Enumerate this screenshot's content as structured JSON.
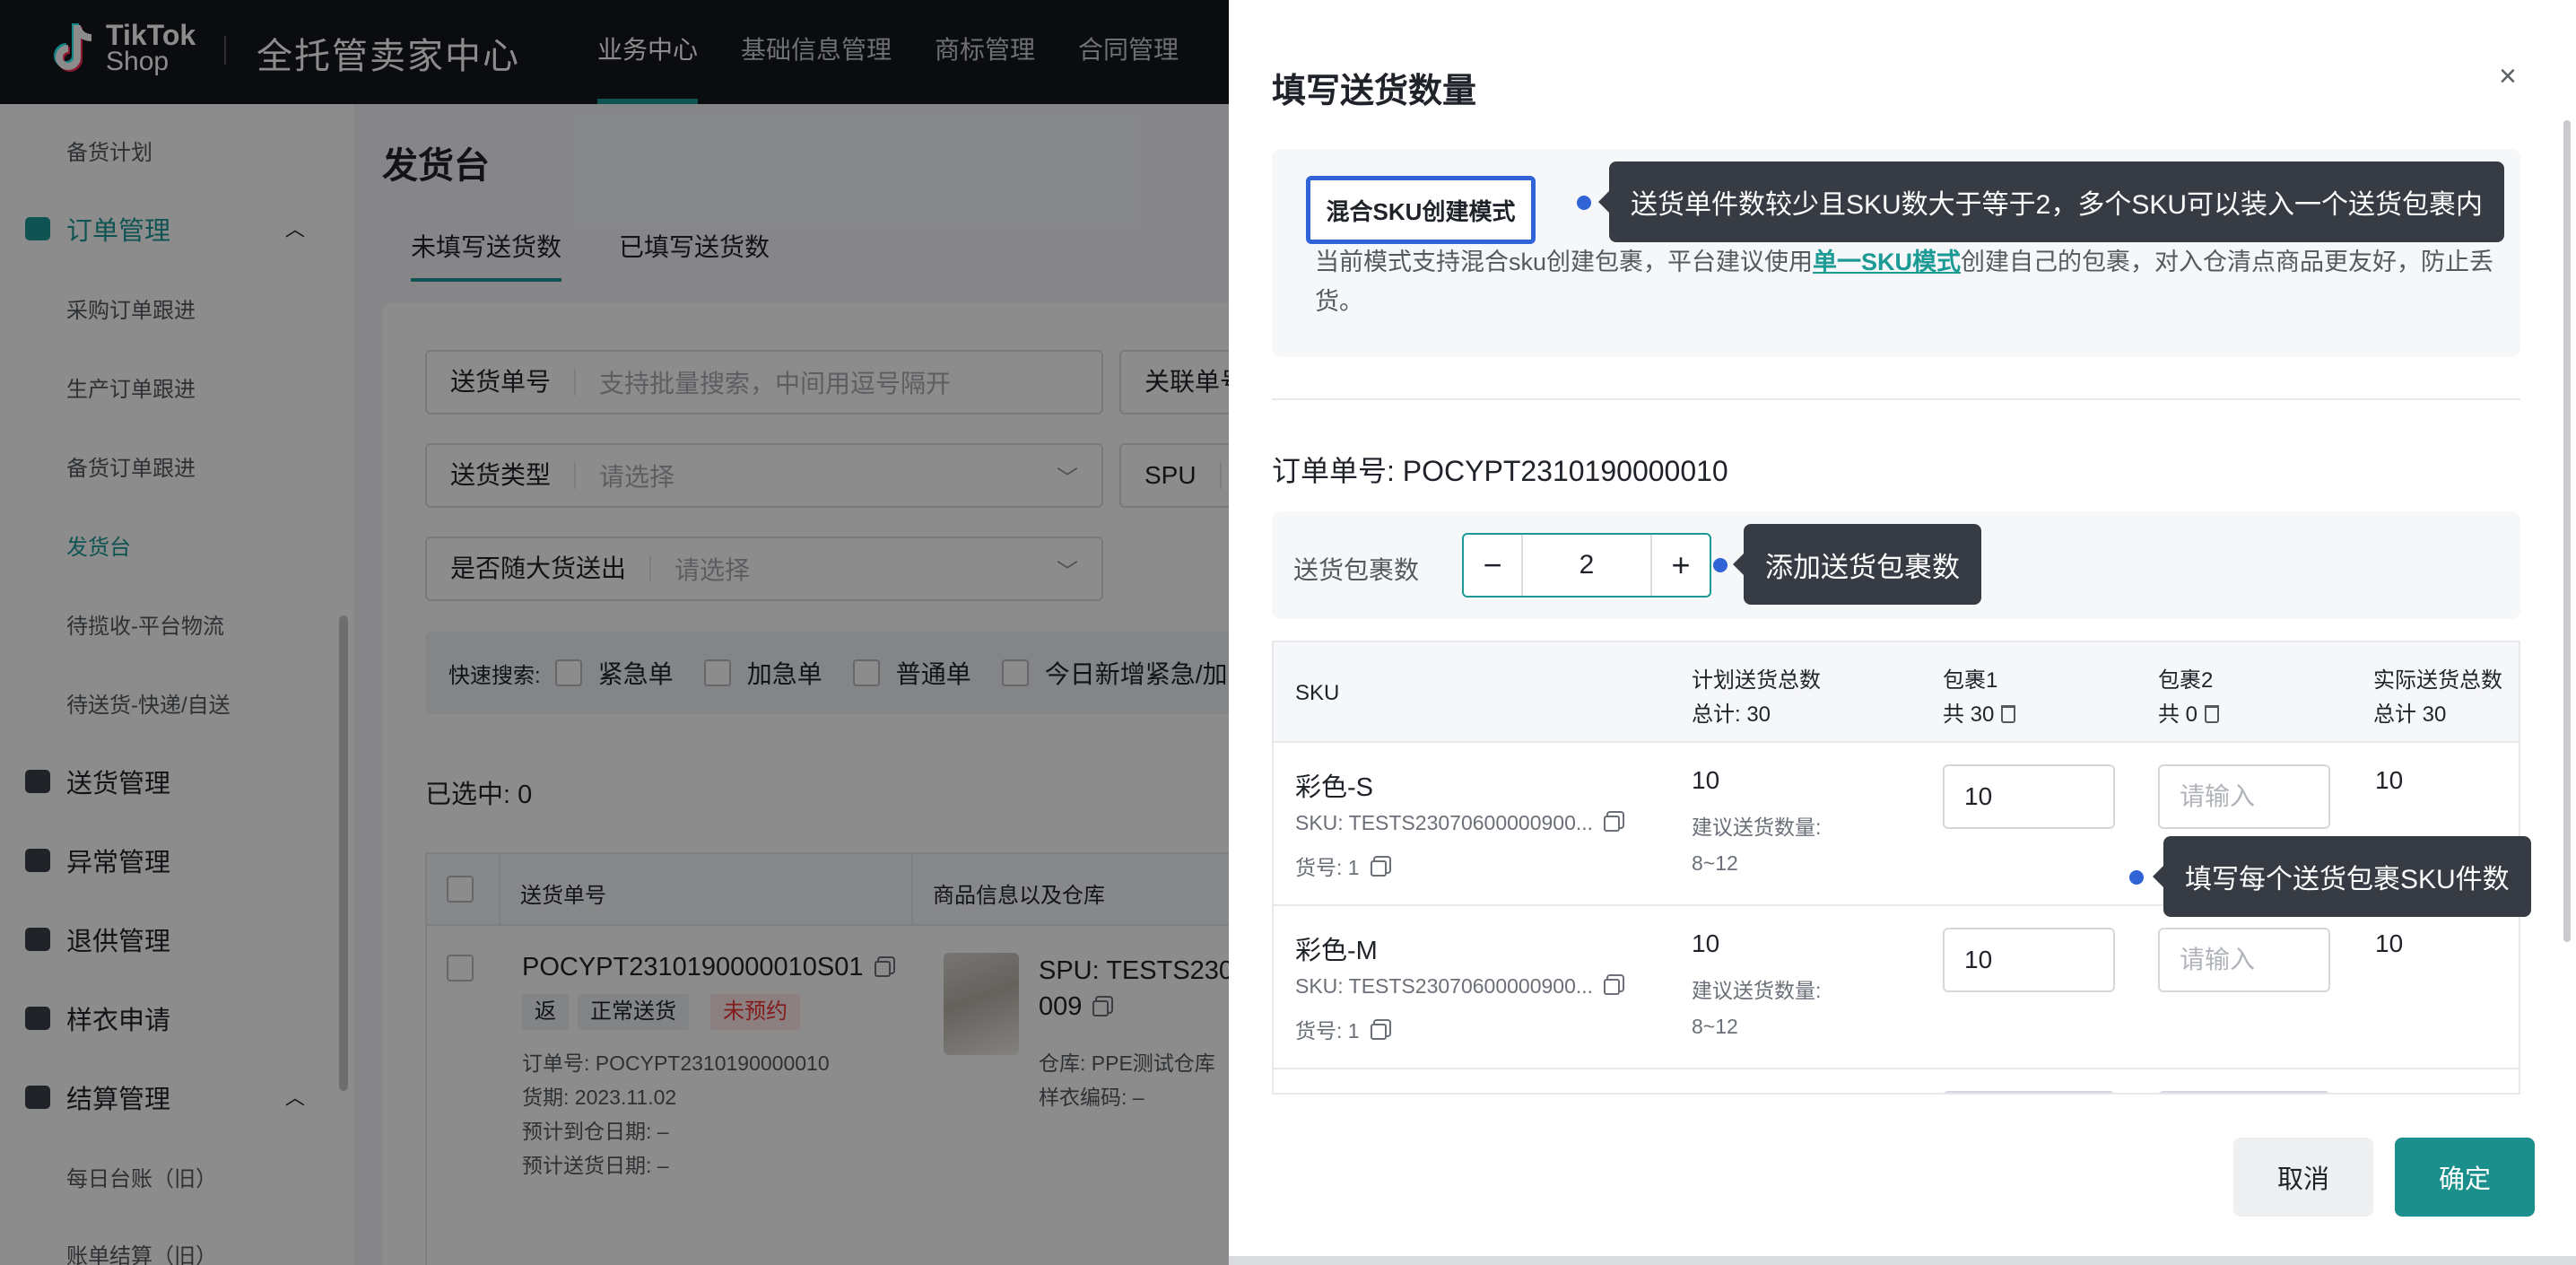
{
  "brand": {
    "logo_line1": "TikTok",
    "logo_line2": "Shop",
    "title": "全托管卖家中心"
  },
  "topnav": [
    "业务中心",
    "基础信息管理",
    "商标管理",
    "合同管理"
  ],
  "sidebar": {
    "items": [
      {
        "label": "备货计划"
      },
      {
        "label": "订单管理"
      },
      {
        "label": "采购订单跟进"
      },
      {
        "label": "生产订单跟进"
      },
      {
        "label": "备货订单跟进"
      },
      {
        "label": "发货台"
      },
      {
        "label": "待揽收-平台物流"
      },
      {
        "label": "待送货-快递/自送"
      },
      {
        "label": "送货管理"
      },
      {
        "label": "异常管理"
      },
      {
        "label": "退供管理"
      },
      {
        "label": "样衣申请"
      },
      {
        "label": "结算管理"
      },
      {
        "label": "每日台账（旧）"
      },
      {
        "label": "账单结算（旧）"
      }
    ]
  },
  "page": {
    "title": "发货台",
    "tabs": [
      "未填写送货数",
      "已填写送货数"
    ],
    "filters": {
      "delivery_no_label": "送货单号",
      "delivery_no_placeholder": "支持批量搜索，中间用逗号隔开",
      "related_no_label": "关联单号",
      "type_label": "送货类型",
      "type_placeholder": "请选择",
      "spu_label": "SPU",
      "follow_label": "是否随大货送出",
      "follow_placeholder": "请选择"
    },
    "quick_search": {
      "label": "快速搜索:",
      "options": [
        "紧急单",
        "加急单",
        "普通单",
        "今日新增紧急/加"
      ]
    },
    "selected": "已选中: 0",
    "table": {
      "headers": [
        "送货单号",
        "商品信息以及仓库"
      ],
      "row": {
        "order": "POCYPT2310190000010S01",
        "tags": [
          "返",
          "正常送货",
          "未预约"
        ],
        "meta": [
          "订单号: POCYPT2310190000010",
          "货期: 2023.11.02",
          "预计到仓日期: –",
          "预计送货日期: –"
        ],
        "spu_line1": "SPU: TESTS230",
        "spu_line2": "009",
        "warehouse": "仓库: PPE测试仓库",
        "sample_code": "样衣编码: –"
      }
    }
  },
  "drawer": {
    "title": "填写送货数量",
    "close": "×",
    "mode_button": "混合SKU创建模式",
    "mode_desc_before": "当前模式支持混合sku创建包裹，平台建议使用",
    "mode_desc_link": "单一SKU模式",
    "mode_desc_after": "创建自己的包裹，对入仓清点商品更友好，防止丢货。",
    "order_no": "订单单号: POCYPT2310190000010",
    "package_label": "送货包裹数",
    "package_minus": "−",
    "package_plus": "+",
    "package_count": "2",
    "table": {
      "h_sku": "SKU",
      "h_plan": "计划送货总数",
      "h_plan_sub": "总计: 30",
      "h_pkg1": "包裹1",
      "h_pkg1_sub": "共 30",
      "h_pkg2": "包裹2",
      "h_pkg2_sub": "共 0",
      "h_actual": "实际送货总数",
      "h_actual_sub": "总计 30",
      "rows": [
        {
          "name": "彩色-S",
          "sku": "SKU: TESTS23070600000900...",
          "hno": "货号: 1",
          "plan": "10",
          "suggest_label": "建议送货数量:",
          "suggest_range": "8~12",
          "pkg1": "10",
          "pkg2_placeholder": "请输入",
          "actual": "10"
        },
        {
          "name": "彩色-M",
          "sku": "SKU: TESTS23070600000900...",
          "hno": "货号: 1",
          "plan": "10",
          "suggest_label": "建议送货数量:",
          "suggest_range": "8~12",
          "pkg1": "10",
          "pkg2_placeholder": "请输入",
          "actual": "10"
        }
      ]
    },
    "cancel": "取消",
    "confirm": "确定"
  },
  "tooltips": {
    "mode": "送货单件数较少且SKU数大于等于2，多个SKU可以装入一个送货包裹内",
    "package": "添加送货包裹数",
    "per_package": "填写每个送货包裹SKU件数"
  },
  "colors": {
    "accent": "#1c9a95",
    "highlight": "#2f63d6",
    "tooltip_bg": "#373c44",
    "alert": "#e33333"
  }
}
